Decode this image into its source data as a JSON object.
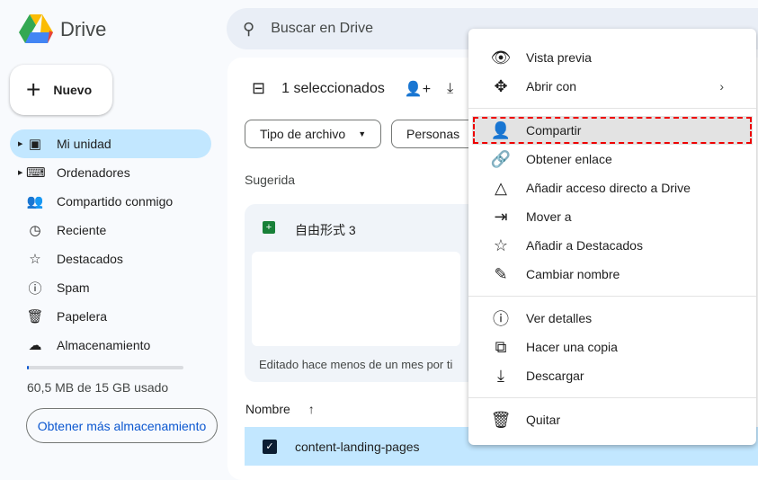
{
  "app": {
    "name": "Drive"
  },
  "search": {
    "placeholder": "Buscar en Drive"
  },
  "new_button": "Nuevo",
  "sidebar": {
    "items": [
      {
        "label": "Mi unidad",
        "icon": "my-drive-icon"
      },
      {
        "label": "Ordenadores",
        "icon": "computers-icon"
      },
      {
        "label": "Compartido conmigo",
        "icon": "shared-icon"
      },
      {
        "label": "Reciente",
        "icon": "clock-icon"
      },
      {
        "label": "Destacados",
        "icon": "star-icon"
      },
      {
        "label": "Spam",
        "icon": "spam-icon"
      },
      {
        "label": "Papelera",
        "icon": "trash-icon"
      },
      {
        "label": "Almacenamiento",
        "icon": "cloud-icon"
      }
    ],
    "storage_used": "60,5 MB de 15 GB usado",
    "storage_fraction": 0.004,
    "get_more": "Obtener más almacenamiento"
  },
  "main": {
    "selected": "1 seleccionados",
    "filters": [
      "Tipo de archivo",
      "Personas"
    ],
    "suggested": "Sugerida",
    "card": {
      "title": "自由形式 3",
      "subtitle": "Editado hace menos de un mes por ti"
    },
    "column_name": "Nombre",
    "row": "content-landing-pages"
  },
  "menu": {
    "items": [
      "Vista previa",
      "Abrir con",
      "Compartir",
      "Obtener enlace",
      "Añadir acceso directo a Drive",
      "Mover a",
      "Añadir a Destacados",
      "Cambiar nombre",
      "Ver detalles",
      "Hacer una copia",
      "Descargar",
      "Quitar"
    ]
  }
}
